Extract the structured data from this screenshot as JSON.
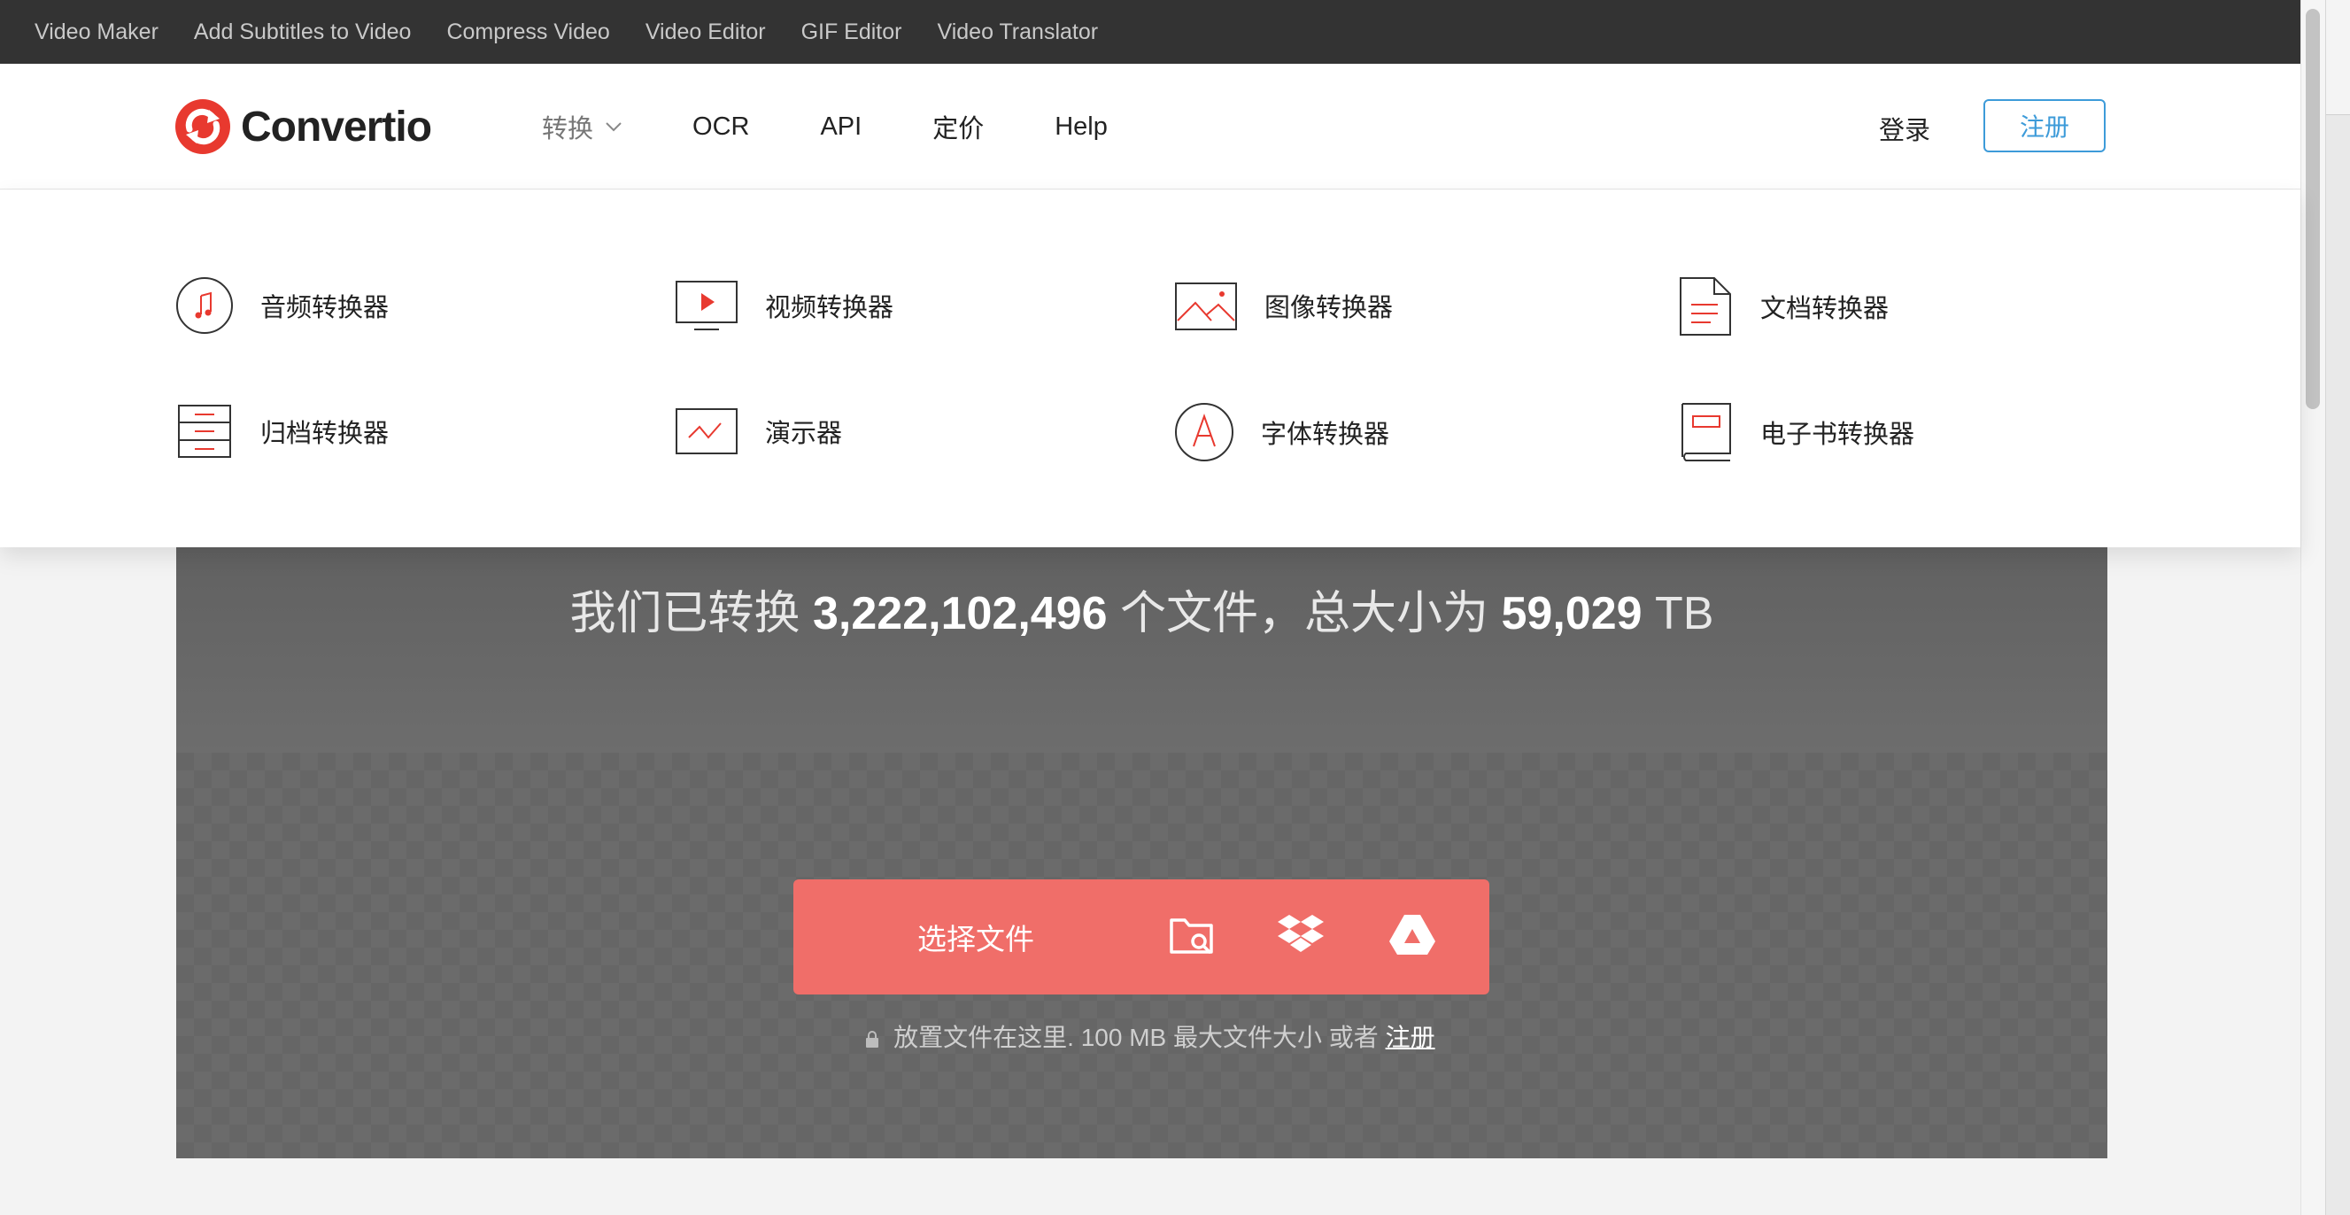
{
  "topbar": {
    "links": [
      "Video Maker",
      "Add Subtitles to Video",
      "Compress Video",
      "Video Editor",
      "GIF Editor",
      "Video Translator"
    ]
  },
  "header": {
    "logo_text": "Convertio",
    "nav": {
      "convert": "转换",
      "ocr": "OCR",
      "api": "API",
      "pricing": "定价",
      "help": "Help"
    },
    "login": "登录",
    "register": "注册"
  },
  "dropdown": {
    "audio": "音频转换器",
    "video": "视频转换器",
    "image": "图像转换器",
    "document": "文档转换器",
    "archive": "归档转换器",
    "presentation": "演示器",
    "font": "字体转换器",
    "ebook": "电子书转换器"
  },
  "stats": {
    "prefix": "我们已转换",
    "files": "3,222,102,496",
    "middle": "个文件，总大小为",
    "size": "59,029",
    "unit": "TB"
  },
  "upload": {
    "choose_files": "选择文件",
    "hint": "放置文件在这里. 100 MB 最大文件大小 或者",
    "hint_link": "注册"
  },
  "colors": {
    "accent_red": "#f06e69",
    "brand_red": "#e8392f",
    "link_blue": "#3d9bd9",
    "top_strip": "#333333",
    "hero_gray": "#6b6b6b"
  },
  "icons": {
    "logo": "convertio-logo-icon",
    "folder_search": "folder-search-icon",
    "dropbox": "dropbox-icon",
    "google_drive": "google-drive-icon",
    "lock": "lock-icon"
  }
}
